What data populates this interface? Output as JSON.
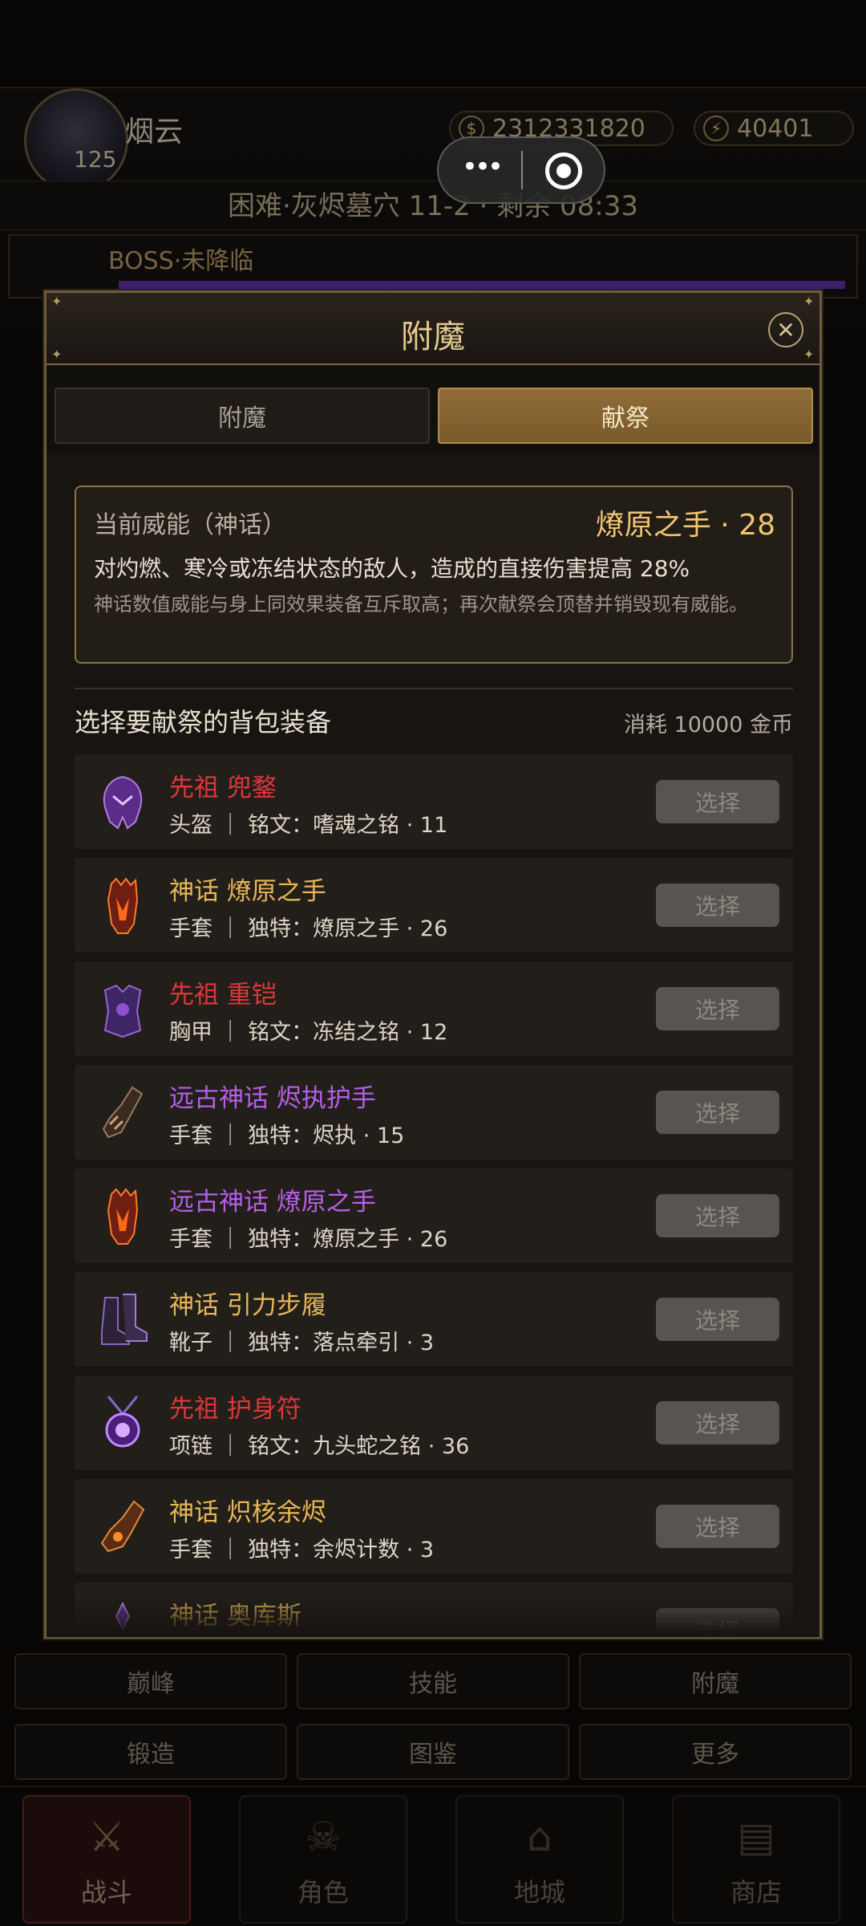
{
  "hud": {
    "player_name": "烟云",
    "level": "125",
    "gold": "2312331820",
    "energy": "40401",
    "stage": "困难·灰烬墓穴 11-2 · 剩余 08:33",
    "boss": "BOSS·未降临",
    "boss_bar_color": "#5c2fa8",
    "mini_controls": {
      "more": "•••",
      "target": "◎"
    }
  },
  "bottom_buttons": [
    "巅峰",
    "技能",
    "附魔",
    "锻造",
    "图鉴",
    "更多"
  ],
  "nav": {
    "items": [
      {
        "label": "战斗",
        "icon": "crossed-swords-icon",
        "glyph": "⚔"
      },
      {
        "label": "角色",
        "icon": "skull-helmet-icon",
        "glyph": "☠"
      },
      {
        "label": "地城",
        "icon": "dungeon-gate-icon",
        "glyph": "⌂"
      },
      {
        "label": "商店",
        "icon": "chest-icon",
        "glyph": "▤"
      }
    ]
  },
  "modal": {
    "title": "附魔",
    "close_icon": "close-icon",
    "tabs": [
      {
        "label": "附魔",
        "active": false
      },
      {
        "label": "献祭",
        "active": true
      }
    ],
    "power": {
      "label": "当前威能（神话）",
      "value": "燎原之手 · 28",
      "desc": "对灼燃、寒冷或冻结状态的敌人，造成的直接伤害提高 28%",
      "note": "神话数值威能与身上同效果装备互斥取高；再次献祭会顶替并销毁现有威能。"
    },
    "section_title": "选择要献祭的背包装备",
    "cost": "消耗 10000 金币",
    "select_label": "选择",
    "items": [
      {
        "name": "先祖 兜鍪",
        "rarity": "red",
        "sub": "头盔 ｜ 铭文：嗜魂之铭 · 11",
        "icon": "helmet-icon"
      },
      {
        "name": "神话 燎原之手",
        "rarity": "gold",
        "sub": "手套 ｜ 独特：燎原之手 · 26",
        "icon": "flame-gauntlet-icon"
      },
      {
        "name": "先祖 重铠",
        "rarity": "red",
        "sub": "胸甲 ｜ 铭文：冻结之铭 · 12",
        "icon": "chest-armor-icon"
      },
      {
        "name": "远古神话 烬执护手",
        "rarity": "purple",
        "sub": "手套 ｜ 独特：烬执 · 15",
        "icon": "gauntlet-icon"
      },
      {
        "name": "远古神话 燎原之手",
        "rarity": "purple",
        "sub": "手套 ｜ 独特：燎原之手 · 26",
        "icon": "flame-gauntlet-icon"
      },
      {
        "name": "神话 引力步履",
        "rarity": "gold",
        "sub": "靴子 ｜ 独特：落点牵引 · 3",
        "icon": "boots-icon"
      },
      {
        "name": "先祖 护身符",
        "rarity": "red",
        "sub": "项链 ｜ 铭文：九头蛇之铭 · 36",
        "icon": "amulet-icon"
      },
      {
        "name": "神话 炽核余烬",
        "rarity": "gold",
        "sub": "手套 ｜ 独特：余烬计数 · 3",
        "icon": "ember-glove-icon"
      },
      {
        "name": "神话 奥库斯",
        "rarity": "gold",
        "sub": "",
        "icon": "staff-icon"
      }
    ]
  }
}
